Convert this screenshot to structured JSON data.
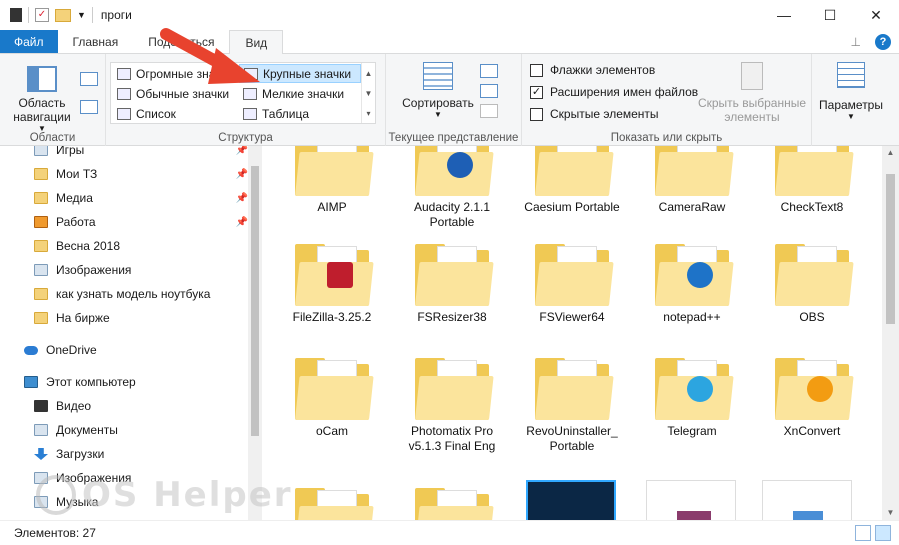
{
  "window": {
    "title": "проги"
  },
  "tabs": [
    {
      "label": "Файл"
    },
    {
      "label": "Главная"
    },
    {
      "label": "Поделиться"
    },
    {
      "label": "Вид"
    }
  ],
  "ribbon": {
    "panes": {
      "nav_pane_label": "Область навигации",
      "group_label": "Области"
    },
    "layout": {
      "group_label": "Структура",
      "items": [
        {
          "label": "Огромные значки"
        },
        {
          "label": "Крупные значки"
        },
        {
          "label": "Обычные значки"
        },
        {
          "label": "Мелкие значки"
        },
        {
          "label": "Список"
        },
        {
          "label": "Таблица"
        }
      ],
      "selected": "Крупные значки"
    },
    "current_view": {
      "sort_label": "Сортировать",
      "group_label": "Текущее представление"
    },
    "show_hide": {
      "group_label": "Показать или скрыть",
      "checkboxes": [
        {
          "label": "Флажки элементов",
          "checked": false
        },
        {
          "label": "Расширения имен файлов",
          "checked": true
        },
        {
          "label": "Скрытые элементы",
          "checked": false
        }
      ],
      "hide_selected_label": "Скрыть выбранные элементы"
    },
    "options": {
      "label": "Параметры"
    }
  },
  "nav": {
    "items": [
      {
        "label": "Игры",
        "icon": "games-icon",
        "pinned": true
      },
      {
        "label": "Мои ТЗ",
        "icon": "folder-icon",
        "pinned": true
      },
      {
        "label": "Медиа",
        "icon": "folder-icon",
        "pinned": true
      },
      {
        "label": "Работа",
        "icon": "work-icon",
        "pinned": true
      },
      {
        "label": "Весна 2018",
        "icon": "folder-icon",
        "pinned": false
      },
      {
        "label": "Изображения",
        "icon": "pictures-icon",
        "pinned": false
      },
      {
        "label": "как узнать модель ноутбука",
        "icon": "folder-icon",
        "pinned": false
      },
      {
        "label": "На бирже",
        "icon": "folder-icon",
        "pinned": false
      },
      {
        "label": "OneDrive",
        "icon": "onedrive-icon",
        "pinned": false
      },
      {
        "label": "Этот компьютер",
        "icon": "computer-icon",
        "pinned": false
      },
      {
        "label": "Видео",
        "icon": "video-icon",
        "pinned": false
      },
      {
        "label": "Документы",
        "icon": "documents-icon",
        "pinned": false
      },
      {
        "label": "Загрузки",
        "icon": "downloads-icon",
        "pinned": false
      },
      {
        "label": "Изображения",
        "icon": "pictures-icon",
        "pinned": false
      },
      {
        "label": "Музыка",
        "icon": "music-icon",
        "pinned": false
      }
    ]
  },
  "files": [
    {
      "name": "AIMP"
    },
    {
      "name": "Audacity 2.1.1 Portable"
    },
    {
      "name": "Caesium Portable"
    },
    {
      "name": "CameraRaw"
    },
    {
      "name": "CheckText8"
    },
    {
      "name": "FileZilla-3.25.2"
    },
    {
      "name": "FSResizer38"
    },
    {
      "name": "FSViewer64"
    },
    {
      "name": "notepad++"
    },
    {
      "name": "OBS"
    },
    {
      "name": "oCam"
    },
    {
      "name": "Photomatix Pro v5.1.3 Final Eng"
    },
    {
      "name": "RevoUninstaller_ Portable"
    },
    {
      "name": "Telegram"
    },
    {
      "name": "XnConvert"
    }
  ],
  "status": {
    "items_count": "Элементов: 27"
  },
  "watermark": {
    "text": "OS Helper"
  },
  "colors": {
    "accent": "#1979ca",
    "arrow": "#e8432e",
    "folder": "#f0c954"
  }
}
